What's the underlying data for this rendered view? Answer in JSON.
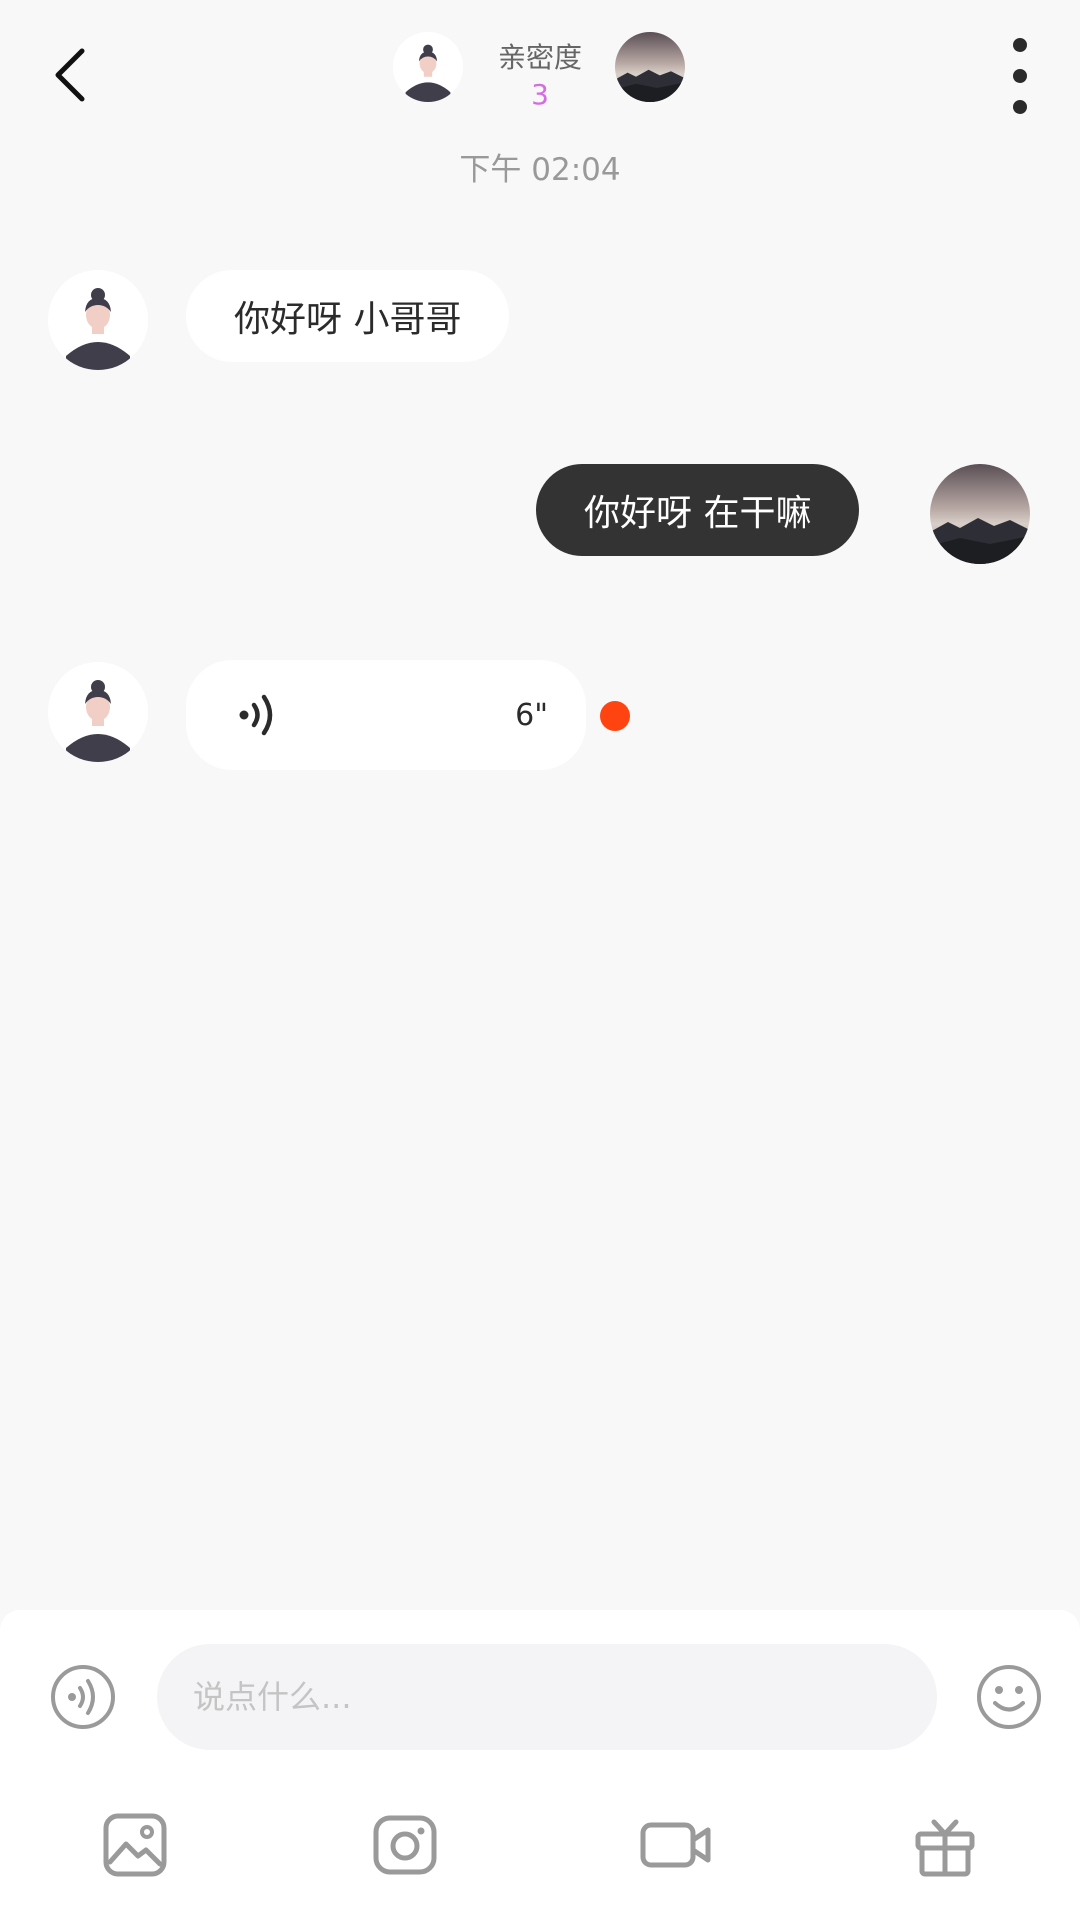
{
  "header": {
    "intimacy_label": "亲密度",
    "intimacy_value": "3"
  },
  "chat": {
    "timestamp": "下午 02:04",
    "messages": [
      {
        "direction": "incoming",
        "type": "text",
        "text": "你好呀 小哥哥"
      },
      {
        "direction": "outgoing",
        "type": "text",
        "text": "你好呀 在干嘛"
      },
      {
        "direction": "incoming",
        "type": "voice",
        "duration": "6\"",
        "unread": true
      }
    ]
  },
  "input": {
    "placeholder": "说点什么..."
  },
  "toolbar": {
    "items": [
      {
        "icon": "image-icon"
      },
      {
        "icon": "camera-icon"
      },
      {
        "icon": "video-icon"
      },
      {
        "icon": "gift-icon"
      }
    ]
  },
  "colors": {
    "background": "#f8f8f9",
    "outgoing_bubble": "#333333",
    "incoming_bubble": "#ffffff",
    "intimacy_accent": "#d26ee0",
    "unread_dot": "#ff4411"
  }
}
